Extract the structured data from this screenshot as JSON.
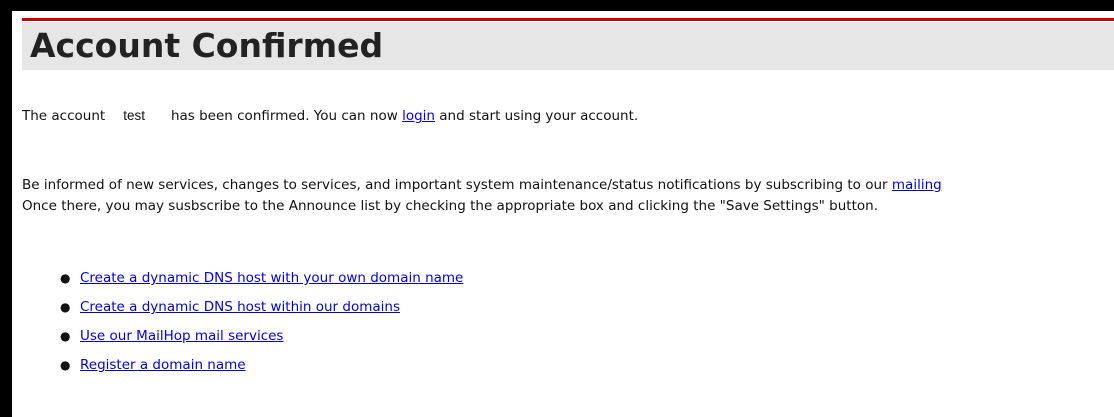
{
  "header": {
    "title": "Account Confirmed"
  },
  "confirmation": {
    "prefix": "The account",
    "username": "test",
    "middle": "has been confirmed. You can now",
    "login_link": "login",
    "suffix": "and start using your account."
  },
  "mailing": {
    "line1_text": "Be informed of new services, changes to services, and important system maintenance/status notifications by subscribing to our",
    "link_text": "mailing",
    "line2_text": "Once there, you may susbscribe to the Announce list by checking the appropriate box and clicking the \"Save Settings\" button."
  },
  "links": [
    "Create a dynamic DNS host with your own domain name",
    "Create a dynamic DNS host within our domains",
    "Use our MailHop mail services",
    "Register a domain name"
  ],
  "colors": {
    "rule": "#cc0000",
    "title_bg": "#e6e6e6",
    "link": "#0000ee"
  }
}
